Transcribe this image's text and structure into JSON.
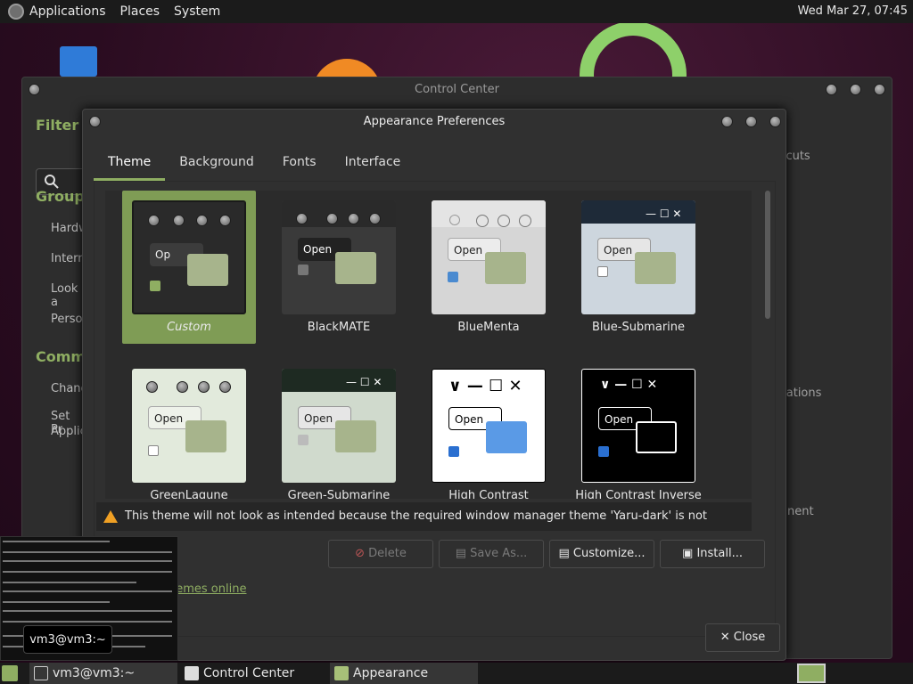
{
  "topbar": {
    "menus": [
      "Applications",
      "Places",
      "System"
    ],
    "clock": "Wed Mar 27, 07:45"
  },
  "control_center": {
    "title": "Control Center",
    "filter": "Filter",
    "groups": "Groups",
    "group_items": [
      "Hardw",
      "Intern",
      "Look a",
      "Perso"
    ],
    "common": "Commo",
    "common_items": [
      "Chang",
      "Set Pr",
      "Applic"
    ],
    "right_labels": [
      "rtcuts",
      "ications",
      "nent"
    ]
  },
  "appearance": {
    "title": "Appearance Preferences",
    "tabs": [
      "Theme",
      "Background",
      "Fonts",
      "Interface"
    ],
    "themes": [
      {
        "name": "Custom",
        "open": "Op",
        "selected": true
      },
      {
        "name": "BlackMATE",
        "open": "Open"
      },
      {
        "name": "BlueMenta",
        "open": "Open"
      },
      {
        "name": "Blue-Submarine",
        "open": "Open"
      },
      {
        "name": "GreenLagune",
        "open": "Open"
      },
      {
        "name": "Green-Submarine",
        "open": "Open"
      },
      {
        "name": "High Contrast",
        "open": "Open"
      },
      {
        "name": "High Contrast Inverse",
        "open": "Open"
      }
    ],
    "warning": "This theme will not look as intended because the required window manager theme 'Yaru-dark' is not installed.",
    "buttons": {
      "delete": "Delete",
      "save_as": "Save As...",
      "customize": "Customize...",
      "install": "Install..."
    },
    "link": "hemes online",
    "close": "Close"
  },
  "terminal_tip": "vm3@vm3:~",
  "taskbar": {
    "items": [
      "vm3@vm3:~",
      "Control Center",
      "Appearance Prefere..."
    ]
  },
  "colors": {
    "accent": "#8fae62",
    "warning": "#f0a024",
    "panel": "#303030"
  }
}
